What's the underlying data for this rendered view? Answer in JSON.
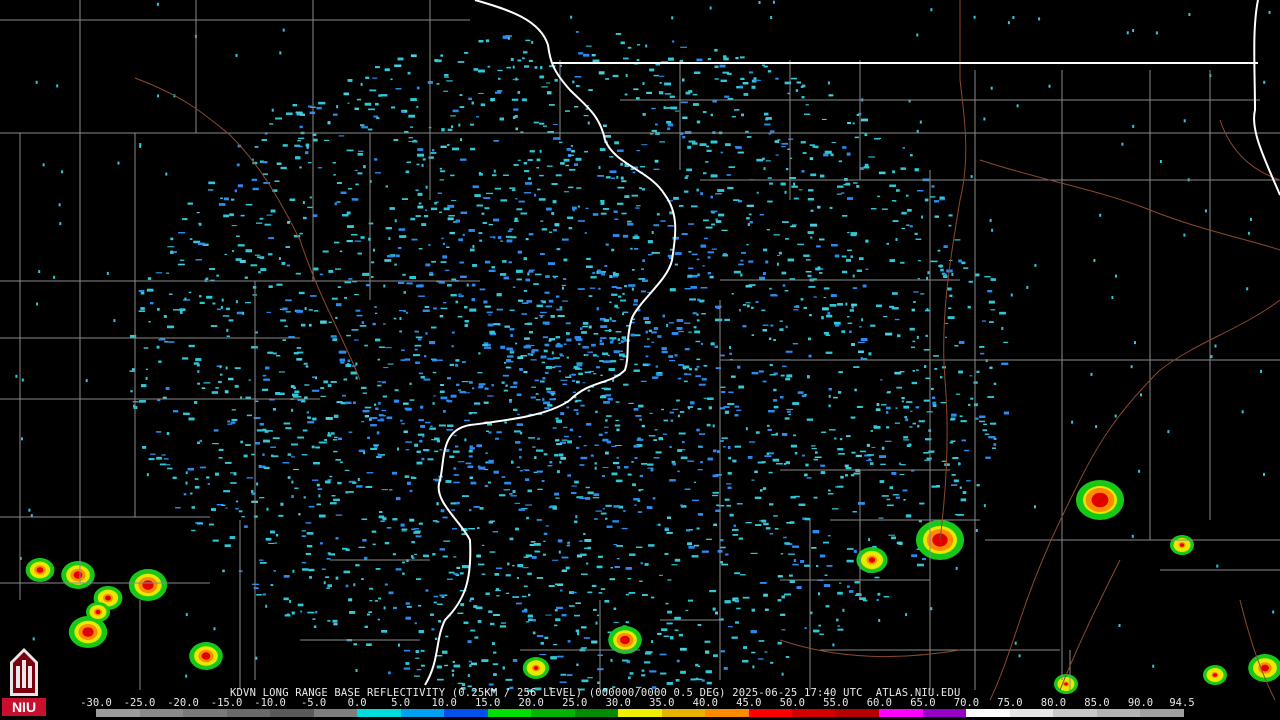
{
  "caption": {
    "station": "KDVN",
    "product": "LONG RANGE BASE REFLECTIVITY",
    "resolution": "(0.25KM / 256 LEVEL)",
    "sequence": "(000000/0000 0.5 DEG)",
    "datetime": "2025-06-25 17:40 UTC",
    "source": "ATLAS.NIU.EDU"
  },
  "logo": {
    "icon": "niu-tower-icon",
    "text": "NIU"
  },
  "scale": {
    "labels": [
      "-30.0",
      "-25.0",
      "-20.0",
      "-15.0",
      "-10.0",
      "-5.0",
      "0.0",
      "5.0",
      "10.0",
      "15.0",
      "20.0",
      "25.0",
      "30.0",
      "35.0",
      "40.0",
      "45.0",
      "50.0",
      "55.0",
      "60.0",
      "65.0",
      "70.0",
      "75.0",
      "80.0",
      "85.0",
      "90.0",
      "94.5"
    ],
    "colors": [
      "#9c9c9c",
      "#8a8a8a",
      "#7a7a7a",
      "#6a6a6a",
      "#5a5a5a",
      "#7e7e7e",
      "#00dcdc",
      "#00a0f0",
      "#0050f0",
      "#00e000",
      "#00b400",
      "#008c00",
      "#f0f000",
      "#e6b400",
      "#ff8c00",
      "#ff0000",
      "#d20000",
      "#b40000",
      "#ff00ff",
      "#9600c8",
      "#ffffff",
      "#e6e6e6",
      "#c8c8c8",
      "#b4b4b4",
      "#a0a0a0"
    ]
  },
  "map_features": {
    "radar_site": "KDVN",
    "state_borders_color": "#ffffff",
    "county_lines_color": "#8a8a8a",
    "highways_color": "#8b4a2b",
    "storm_cells": [
      {
        "area": "west",
        "max_dbz": 45
      },
      {
        "area": "south",
        "max_dbz": 45
      },
      {
        "area": "east",
        "max_dbz": 50
      }
    ]
  }
}
